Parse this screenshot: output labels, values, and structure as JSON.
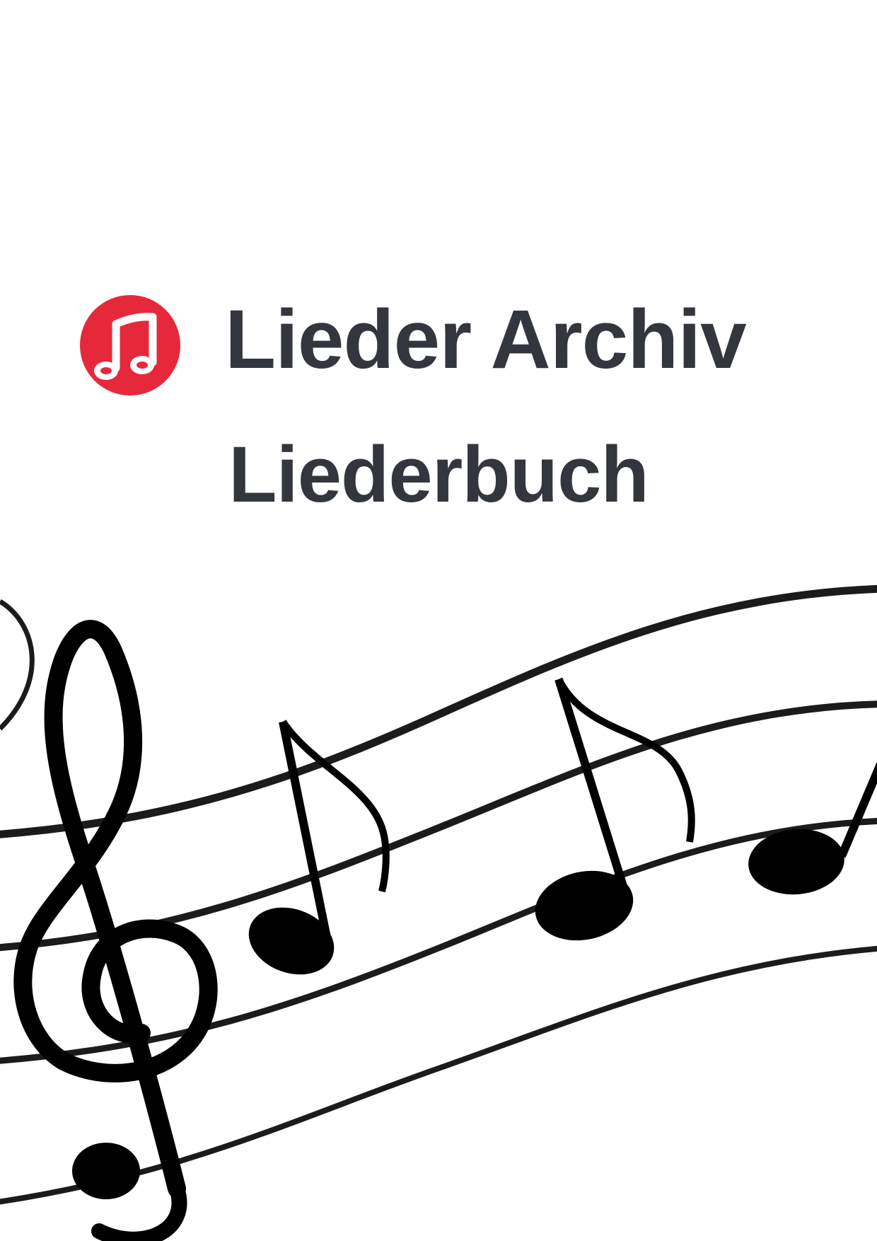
{
  "brand": {
    "name": "Lieder Archiv",
    "logo_icon": "music-note-icon",
    "logo_color": "#e5293b"
  },
  "title": "Liederbuch",
  "text_color": "#33373d",
  "illustration": {
    "icon": "sheet-music-staff-icon",
    "elements": [
      "treble-clef",
      "eighth-note",
      "eighth-note",
      "eighth-note"
    ]
  }
}
